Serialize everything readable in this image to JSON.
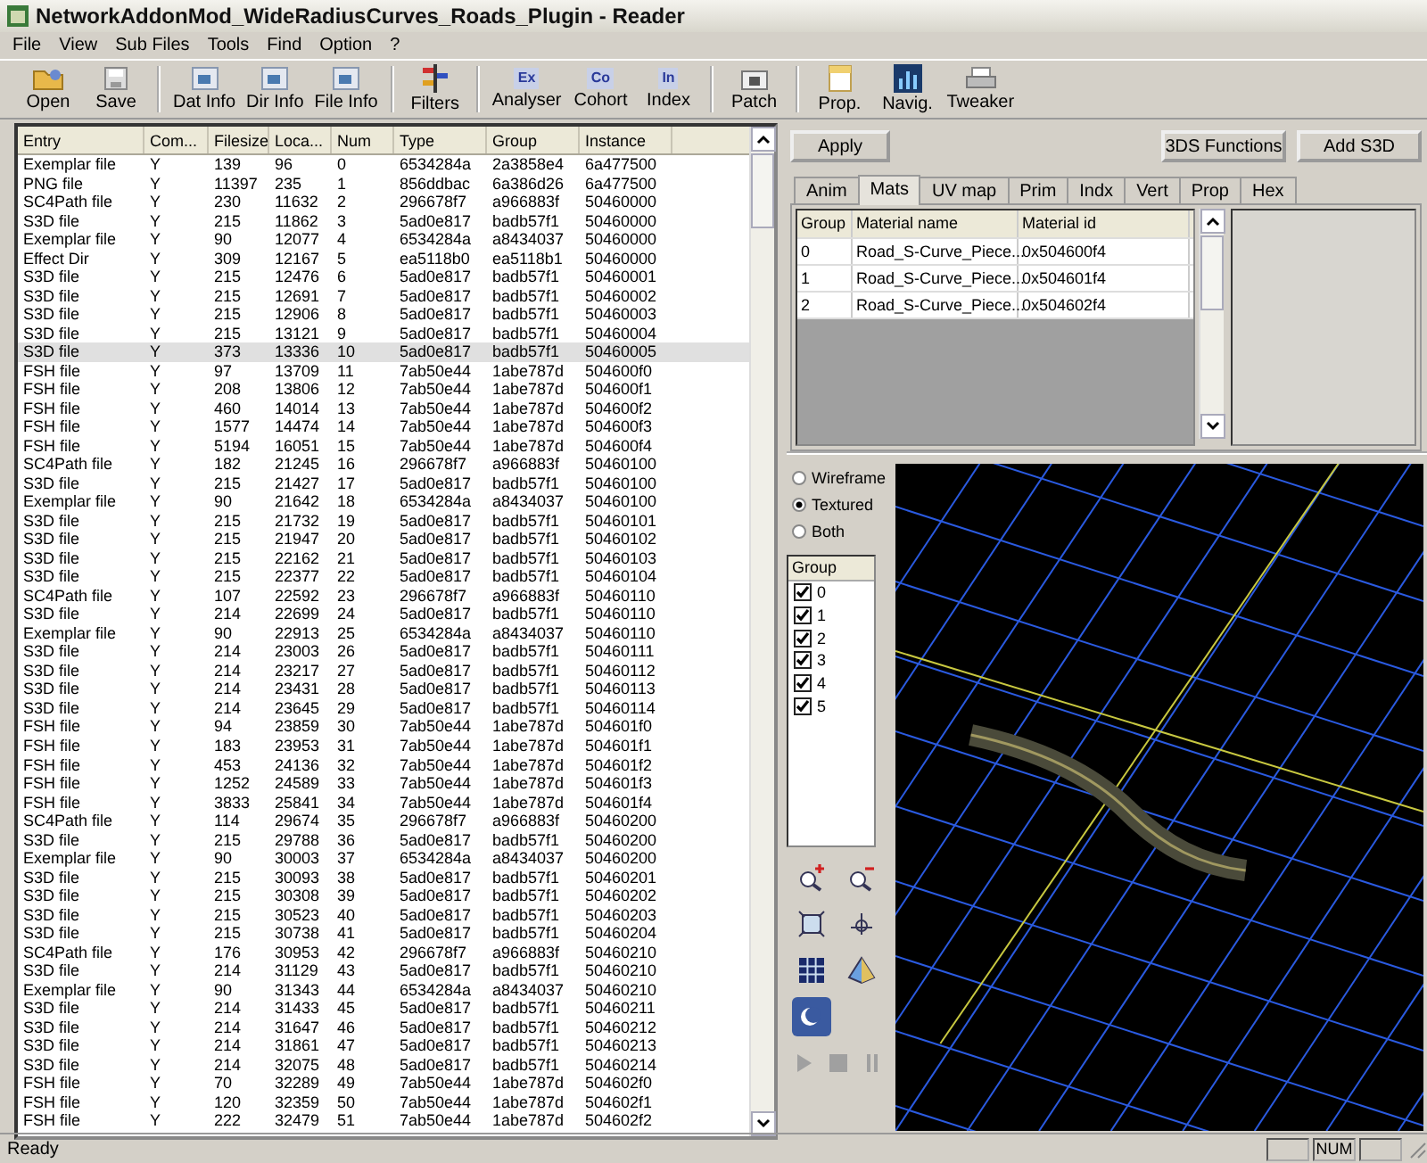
{
  "window": {
    "title": "NetworkAddonMod_WideRadiusCurves_Roads_Plugin - Reader"
  },
  "menu": [
    "File",
    "View",
    "Sub Files",
    "Tools",
    "Find",
    "Option",
    "?"
  ],
  "toolbar": [
    [
      {
        "label": "Open",
        "kind": "folder"
      },
      {
        "label": "Save",
        "kind": "disk"
      }
    ],
    [
      {
        "label": "Dat Info",
        "kind": "doc"
      },
      {
        "label": "Dir Info",
        "kind": "doc"
      },
      {
        "label": "File Info",
        "kind": "doc"
      }
    ],
    [
      {
        "label": "Filters",
        "kind": "filter"
      }
    ],
    [
      {
        "label": "Analyser",
        "kind": "letters",
        "glyph": "Ex"
      },
      {
        "label": "Cohort",
        "kind": "letters",
        "glyph": "Co"
      },
      {
        "label": "Index",
        "kind": "letters",
        "glyph": "In"
      }
    ],
    [
      {
        "label": "Patch",
        "kind": "patch"
      }
    ],
    [
      {
        "label": "Prop.",
        "kind": "page"
      },
      {
        "label": "Navig.",
        "kind": "chart"
      },
      {
        "label": "Tweaker",
        "kind": "printer"
      }
    ]
  ],
  "table": {
    "columns": [
      "Entry",
      "Com...",
      "Filesize",
      "Loca...",
      "Num",
      "Type",
      "Group",
      "Instance"
    ],
    "rows": [
      {
        "cells": [
          "Exemplar file",
          "Y",
          "139",
          "96",
          "0",
          "6534284a",
          "2a3858e4",
          "6a477500"
        ],
        "selected": false
      },
      {
        "cells": [
          "PNG file",
          "Y",
          "11397",
          "235",
          "1",
          "856ddbac",
          "6a386d26",
          "6a477500"
        ],
        "selected": false
      },
      {
        "cells": [
          "SC4Path file",
          "Y",
          "230",
          "11632",
          "2",
          "296678f7",
          "a966883f",
          "50460000"
        ],
        "selected": false
      },
      {
        "cells": [
          "S3D file",
          "Y",
          "215",
          "11862",
          "3",
          "5ad0e817",
          "badb57f1",
          "50460000"
        ],
        "selected": false
      },
      {
        "cells": [
          "Exemplar file",
          "Y",
          "90",
          "12077",
          "4",
          "6534284a",
          "a8434037",
          "50460000"
        ],
        "selected": false
      },
      {
        "cells": [
          "Effect Dir",
          "Y",
          "309",
          "12167",
          "5",
          "ea5118b0",
          "ea5118b1",
          "50460000"
        ],
        "selected": false
      },
      {
        "cells": [
          "S3D file",
          "Y",
          "215",
          "12476",
          "6",
          "5ad0e817",
          "badb57f1",
          "50460001"
        ],
        "selected": false
      },
      {
        "cells": [
          "S3D file",
          "Y",
          "215",
          "12691",
          "7",
          "5ad0e817",
          "badb57f1",
          "50460002"
        ],
        "selected": false
      },
      {
        "cells": [
          "S3D file",
          "Y",
          "215",
          "12906",
          "8",
          "5ad0e817",
          "badb57f1",
          "50460003"
        ],
        "selected": false
      },
      {
        "cells": [
          "S3D file",
          "Y",
          "215",
          "13121",
          "9",
          "5ad0e817",
          "badb57f1",
          "50460004"
        ],
        "selected": false
      },
      {
        "cells": [
          "S3D file",
          "Y",
          "373",
          "13336",
          "10",
          "5ad0e817",
          "badb57f1",
          "50460005"
        ],
        "selected": true
      },
      {
        "cells": [
          "FSH file",
          "Y",
          "97",
          "13709",
          "11",
          "7ab50e44",
          "1abe787d",
          "504600f0"
        ],
        "selected": false
      },
      {
        "cells": [
          "FSH file",
          "Y",
          "208",
          "13806",
          "12",
          "7ab50e44",
          "1abe787d",
          "504600f1"
        ],
        "selected": false
      },
      {
        "cells": [
          "FSH file",
          "Y",
          "460",
          "14014",
          "13",
          "7ab50e44",
          "1abe787d",
          "504600f2"
        ],
        "selected": false
      },
      {
        "cells": [
          "FSH file",
          "Y",
          "1577",
          "14474",
          "14",
          "7ab50e44",
          "1abe787d",
          "504600f3"
        ],
        "selected": false
      },
      {
        "cells": [
          "FSH file",
          "Y",
          "5194",
          "16051",
          "15",
          "7ab50e44",
          "1abe787d",
          "504600f4"
        ],
        "selected": false
      },
      {
        "cells": [
          "SC4Path file",
          "Y",
          "182",
          "21245",
          "16",
          "296678f7",
          "a966883f",
          "50460100"
        ],
        "selected": false
      },
      {
        "cells": [
          "S3D file",
          "Y",
          "215",
          "21427",
          "17",
          "5ad0e817",
          "badb57f1",
          "50460100"
        ],
        "selected": false
      },
      {
        "cells": [
          "Exemplar file",
          "Y",
          "90",
          "21642",
          "18",
          "6534284a",
          "a8434037",
          "50460100"
        ],
        "selected": false
      },
      {
        "cells": [
          "S3D file",
          "Y",
          "215",
          "21732",
          "19",
          "5ad0e817",
          "badb57f1",
          "50460101"
        ],
        "selected": false
      },
      {
        "cells": [
          "S3D file",
          "Y",
          "215",
          "21947",
          "20",
          "5ad0e817",
          "badb57f1",
          "50460102"
        ],
        "selected": false
      },
      {
        "cells": [
          "S3D file",
          "Y",
          "215",
          "22162",
          "21",
          "5ad0e817",
          "badb57f1",
          "50460103"
        ],
        "selected": false
      },
      {
        "cells": [
          "S3D file",
          "Y",
          "215",
          "22377",
          "22",
          "5ad0e817",
          "badb57f1",
          "50460104"
        ],
        "selected": false
      },
      {
        "cells": [
          "SC4Path file",
          "Y",
          "107",
          "22592",
          "23",
          "296678f7",
          "a966883f",
          "50460110"
        ],
        "selected": false
      },
      {
        "cells": [
          "S3D file",
          "Y",
          "214",
          "22699",
          "24",
          "5ad0e817",
          "badb57f1",
          "50460110"
        ],
        "selected": false
      },
      {
        "cells": [
          "Exemplar file",
          "Y",
          "90",
          "22913",
          "25",
          "6534284a",
          "a8434037",
          "50460110"
        ],
        "selected": false
      },
      {
        "cells": [
          "S3D file",
          "Y",
          "214",
          "23003",
          "26",
          "5ad0e817",
          "badb57f1",
          "50460111"
        ],
        "selected": false
      },
      {
        "cells": [
          "S3D file",
          "Y",
          "214",
          "23217",
          "27",
          "5ad0e817",
          "badb57f1",
          "50460112"
        ],
        "selected": false
      },
      {
        "cells": [
          "S3D file",
          "Y",
          "214",
          "23431",
          "28",
          "5ad0e817",
          "badb57f1",
          "50460113"
        ],
        "selected": false
      },
      {
        "cells": [
          "S3D file",
          "Y",
          "214",
          "23645",
          "29",
          "5ad0e817",
          "badb57f1",
          "50460114"
        ],
        "selected": false
      },
      {
        "cells": [
          "FSH file",
          "Y",
          "94",
          "23859",
          "30",
          "7ab50e44",
          "1abe787d",
          "504601f0"
        ],
        "selected": false
      },
      {
        "cells": [
          "FSH file",
          "Y",
          "183",
          "23953",
          "31",
          "7ab50e44",
          "1abe787d",
          "504601f1"
        ],
        "selected": false
      },
      {
        "cells": [
          "FSH file",
          "Y",
          "453",
          "24136",
          "32",
          "7ab50e44",
          "1abe787d",
          "504601f2"
        ],
        "selected": false
      },
      {
        "cells": [
          "FSH file",
          "Y",
          "1252",
          "24589",
          "33",
          "7ab50e44",
          "1abe787d",
          "504601f3"
        ],
        "selected": false
      },
      {
        "cells": [
          "FSH file",
          "Y",
          "3833",
          "25841",
          "34",
          "7ab50e44",
          "1abe787d",
          "504601f4"
        ],
        "selected": false
      },
      {
        "cells": [
          "SC4Path file",
          "Y",
          "114",
          "29674",
          "35",
          "296678f7",
          "a966883f",
          "50460200"
        ],
        "selected": false
      },
      {
        "cells": [
          "S3D file",
          "Y",
          "215",
          "29788",
          "36",
          "5ad0e817",
          "badb57f1",
          "50460200"
        ],
        "selected": false
      },
      {
        "cells": [
          "Exemplar file",
          "Y",
          "90",
          "30003",
          "37",
          "6534284a",
          "a8434037",
          "50460200"
        ],
        "selected": false
      },
      {
        "cells": [
          "S3D file",
          "Y",
          "215",
          "30093",
          "38",
          "5ad0e817",
          "badb57f1",
          "50460201"
        ],
        "selected": false
      },
      {
        "cells": [
          "S3D file",
          "Y",
          "215",
          "30308",
          "39",
          "5ad0e817",
          "badb57f1",
          "50460202"
        ],
        "selected": false
      },
      {
        "cells": [
          "S3D file",
          "Y",
          "215",
          "30523",
          "40",
          "5ad0e817",
          "badb57f1",
          "50460203"
        ],
        "selected": false
      },
      {
        "cells": [
          "S3D file",
          "Y",
          "215",
          "30738",
          "41",
          "5ad0e817",
          "badb57f1",
          "50460204"
        ],
        "selected": false
      },
      {
        "cells": [
          "SC4Path file",
          "Y",
          "176",
          "30953",
          "42",
          "296678f7",
          "a966883f",
          "50460210"
        ],
        "selected": false
      },
      {
        "cells": [
          "S3D file",
          "Y",
          "214",
          "31129",
          "43",
          "5ad0e817",
          "badb57f1",
          "50460210"
        ],
        "selected": false
      },
      {
        "cells": [
          "Exemplar file",
          "Y",
          "90",
          "31343",
          "44",
          "6534284a",
          "a8434037",
          "50460210"
        ],
        "selected": false
      },
      {
        "cells": [
          "S3D file",
          "Y",
          "214",
          "31433",
          "45",
          "5ad0e817",
          "badb57f1",
          "50460211"
        ],
        "selected": false
      },
      {
        "cells": [
          "S3D file",
          "Y",
          "214",
          "31647",
          "46",
          "5ad0e817",
          "badb57f1",
          "50460212"
        ],
        "selected": false
      },
      {
        "cells": [
          "S3D file",
          "Y",
          "214",
          "31861",
          "47",
          "5ad0e817",
          "badb57f1",
          "50460213"
        ],
        "selected": false
      },
      {
        "cells": [
          "S3D file",
          "Y",
          "214",
          "32075",
          "48",
          "5ad0e817",
          "badb57f1",
          "50460214"
        ],
        "selected": false
      },
      {
        "cells": [
          "FSH file",
          "Y",
          "70",
          "32289",
          "49",
          "7ab50e44",
          "1abe787d",
          "504602f0"
        ],
        "selected": false
      },
      {
        "cells": [
          "FSH file",
          "Y",
          "120",
          "32359",
          "50",
          "7ab50e44",
          "1abe787d",
          "504602f1"
        ],
        "selected": false
      },
      {
        "cells": [
          "FSH file",
          "Y",
          "222",
          "32479",
          "51",
          "7ab50e44",
          "1abe787d",
          "504602f2"
        ],
        "selected": false
      }
    ]
  },
  "actions": {
    "apply": "Apply",
    "functions": "3DS Functions",
    "add": "Add S3D"
  },
  "tabs": [
    {
      "label": "Anim",
      "selected": false
    },
    {
      "label": "Mats",
      "selected": true
    },
    {
      "label": "UV map",
      "selected": false
    },
    {
      "label": "Prim",
      "selected": false
    },
    {
      "label": "Indx",
      "selected": false
    },
    {
      "label": "Vert",
      "selected": false
    },
    {
      "label": "Prop",
      "selected": false
    },
    {
      "label": "Hex",
      "selected": false
    }
  ],
  "materials": {
    "columns": [
      "Group",
      "Material name",
      "Material id"
    ],
    "rows": [
      [
        "0",
        "Road_S-Curve_Piece...",
        "0x504600f4"
      ],
      [
        "1",
        "Road_S-Curve_Piece...",
        "0x504601f4"
      ],
      [
        "2",
        "Road_S-Curve_Piece...",
        "0x504602f4"
      ]
    ]
  },
  "render_modes": [
    {
      "label": "Wireframe",
      "selected": false
    },
    {
      "label": "Textured",
      "selected": true
    },
    {
      "label": "Both",
      "selected": false
    }
  ],
  "groups": {
    "header": "Group",
    "items": [
      {
        "label": "0",
        "checked": true
      },
      {
        "label": "1",
        "checked": true
      },
      {
        "label": "2",
        "checked": true
      },
      {
        "label": "3",
        "checked": true
      },
      {
        "label": "4",
        "checked": true
      },
      {
        "label": "5",
        "checked": true
      }
    ]
  },
  "view_tools": [
    {
      "kind": "zoom-in",
      "selected": false
    },
    {
      "kind": "zoom-out",
      "selected": false
    },
    {
      "kind": "frame",
      "selected": false
    },
    {
      "kind": "axis",
      "selected": false
    },
    {
      "kind": "grid",
      "selected": false
    },
    {
      "kind": "pyramid",
      "selected": false
    },
    {
      "kind": "light",
      "selected": true
    }
  ],
  "playback": [
    {
      "kind": "play",
      "disabled": true
    },
    {
      "kind": "stop",
      "disabled": true
    },
    {
      "kind": "pause",
      "disabled": true
    }
  ],
  "status_bar": {
    "text": "Ready",
    "indicator": "NUM"
  }
}
